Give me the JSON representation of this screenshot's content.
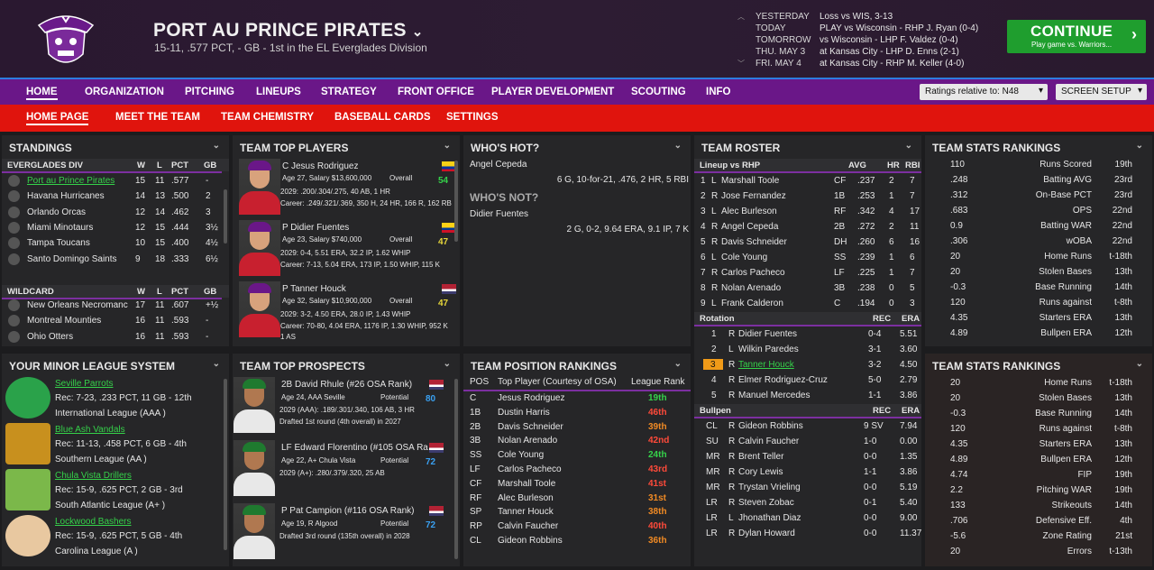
{
  "header": {
    "team_name": "PORT AU PRINCE PIRATES",
    "subtitle": "15-11, .577 PCT, - GB - 1st in the EL Everglades Division",
    "schedule": [
      {
        "label": "YESTERDAY",
        "value": "Loss vs WIS, 3-13"
      },
      {
        "label": "TODAY",
        "value": "PLAY vs Wisconsin - RHP J. Ryan (0-4)"
      },
      {
        "label": "TOMORROW",
        "value": "vs Wisconsin - LHP F. Valdez (0-4)"
      },
      {
        "label": "THU. MAY 3",
        "value": "at Kansas City - LHP D. Enns (2-1)"
      },
      {
        "label": "FRI. MAY 4",
        "value": "at Kansas City - RHP M. Keller (4-0)"
      }
    ],
    "continue_label": "CONTINUE",
    "continue_sub": "Play game vs. Warriors..."
  },
  "nav": {
    "main": [
      "HOME",
      "ORGANIZATION",
      "PITCHING",
      "LINEUPS",
      "STRATEGY",
      "FRONT OFFICE",
      "PLAYER DEVELOPMENT",
      "SCOUTING",
      "INFO"
    ],
    "ratings_dropdown": "Ratings relative to: N48",
    "screen_setup": "SCREEN SETUP",
    "sub": [
      "HOME PAGE",
      "MEET THE TEAM",
      "TEAM CHEMISTRY",
      "BASEBALL CARDS",
      "SETTINGS"
    ]
  },
  "standings": {
    "title": "STANDINGS",
    "div_name": "EVERGLADES DIV",
    "wildcard_name": "WILDCARD",
    "cols": [
      "W",
      "L",
      "PCT",
      "GB"
    ],
    "division": [
      {
        "team": "Port au Prince Pirates",
        "w": "15",
        "l": "11",
        "pct": ".577",
        "gb": "-"
      },
      {
        "team": "Havana Hurricanes",
        "w": "14",
        "l": "13",
        "pct": ".500",
        "gb": "2"
      },
      {
        "team": "Orlando Orcas",
        "w": "12",
        "l": "14",
        "pct": ".462",
        "gb": "3"
      },
      {
        "team": "Miami Minotaurs",
        "w": "12",
        "l": "15",
        "pct": ".444",
        "gb": "3½"
      },
      {
        "team": "Tampa Toucans",
        "w": "10",
        "l": "15",
        "pct": ".400",
        "gb": "4½"
      },
      {
        "team": "Santo Domingo Saints",
        "w": "9",
        "l": "18",
        "pct": ".333",
        "gb": "6½"
      }
    ],
    "wildcard": [
      {
        "team": "New Orleans Necromanc",
        "w": "17",
        "l": "11",
        "pct": ".607",
        "gb": "+½"
      },
      {
        "team": "Montreal Mounties",
        "w": "16",
        "l": "11",
        "pct": ".593",
        "gb": "-"
      },
      {
        "team": "Ohio Otters",
        "w": "16",
        "l": "11",
        "pct": ".593",
        "gb": "-"
      }
    ]
  },
  "top_players": {
    "title": "TEAM TOP PLAYERS",
    "players": [
      {
        "name": "C Jesus Rodriguez",
        "line1": "Age 27, Salary $13,600,000",
        "ovr_label": "Overall",
        "ovr": "54",
        "line2": "2029: .200/.304/.275, 40 AB, 1 HR",
        "line3": "Career: .249/.321/.369, 350 H, 24 HR, 166 R, 162 RB"
      },
      {
        "name": "P Didier Fuentes",
        "line1": "Age 23, Salary $740,000",
        "ovr_label": "Overall",
        "ovr": "47",
        "line2": "2029: 0-4, 5.51 ERA, 32.2 IP, 1.62 WHIP",
        "line3": "Career: 7-13, 5.04 ERA, 173 IP, 1.50 WHIP, 115 K"
      },
      {
        "name": "P Tanner Houck",
        "line1": "Age 32, Salary $10,900,000",
        "ovr_label": "Overall",
        "ovr": "47",
        "line2": "2029: 3-2, 4.50 ERA, 28.0 IP, 1.43 WHIP",
        "line3": "Career: 70-80, 4.04 ERA, 1176 IP, 1.30 WHIP, 952 K",
        "line4": "1 AS"
      }
    ]
  },
  "whos_hot": {
    "title": "WHO'S HOT?",
    "hot_name": "Angel Cepeda",
    "hot_line": "6 G, 10-for-21, .476, 2 HR, 5 RBI",
    "not_title": "WHO'S NOT?",
    "not_name": "Didier Fuentes",
    "not_line": "2 G, 0-2, 9.64 ERA, 9.1 IP, 7 K"
  },
  "roster": {
    "title": "TEAM ROSTER",
    "lineup_label": "Lineup vs RHP",
    "lineup_cols": [
      "AVG",
      "HR",
      "RBI"
    ],
    "lineup": [
      {
        "n": "1",
        "h": "L",
        "name": "Marshall Toole",
        "pos": "CF",
        "avg": ".237",
        "hr": "2",
        "rbi": "7"
      },
      {
        "n": "2",
        "h": "R",
        "name": "Jose Fernandez",
        "pos": "1B",
        "avg": ".253",
        "hr": "1",
        "rbi": "7"
      },
      {
        "n": "3",
        "h": "L",
        "name": "Alec Burleson",
        "pos": "RF",
        "avg": ".342",
        "hr": "4",
        "rbi": "17"
      },
      {
        "n": "4",
        "h": "R",
        "name": "Angel Cepeda",
        "pos": "2B",
        "avg": ".272",
        "hr": "2",
        "rbi": "11"
      },
      {
        "n": "5",
        "h": "R",
        "name": "Davis Schneider",
        "pos": "DH",
        "avg": ".260",
        "hr": "6",
        "rbi": "16"
      },
      {
        "n": "6",
        "h": "L",
        "name": "Cole Young",
        "pos": "SS",
        "avg": ".239",
        "hr": "1",
        "rbi": "6"
      },
      {
        "n": "7",
        "h": "R",
        "name": "Carlos Pacheco",
        "pos": "LF",
        "avg": ".225",
        "hr": "1",
        "rbi": "7"
      },
      {
        "n": "8",
        "h": "R",
        "name": "Nolan Arenado",
        "pos": "3B",
        "avg": ".238",
        "hr": "0",
        "rbi": "5"
      },
      {
        "n": "9",
        "h": "L",
        "name": "Frank Calderon",
        "pos": "C",
        "avg": ".194",
        "hr": "0",
        "rbi": "3"
      }
    ],
    "rotation_label": "Rotation",
    "rot_cols": [
      "REC",
      "ERA"
    ],
    "rotation": [
      {
        "n": "1",
        "h": "R",
        "name": "Didier Fuentes",
        "rec": "0-4",
        "era": "5.51"
      },
      {
        "n": "2",
        "h": "L",
        "name": "Wilkin Paredes",
        "rec": "3-1",
        "era": "3.60"
      },
      {
        "n": "3",
        "h": "R",
        "name": "Tanner Houck",
        "rec": "3-2",
        "era": "4.50",
        "hl": true
      },
      {
        "n": "4",
        "h": "R",
        "name": "Elmer Rodriguez-Cruz",
        "rec": "5-0",
        "era": "2.79"
      },
      {
        "n": "5",
        "h": "R",
        "name": "Manuel Mercedes",
        "rec": "1-1",
        "era": "3.86"
      }
    ],
    "bullpen_label": "Bullpen",
    "bullpen": [
      {
        "role": "CL",
        "h": "R",
        "name": "Gideon Robbins",
        "rec": "9 SV",
        "era": "7.94"
      },
      {
        "role": "SU",
        "h": "R",
        "name": "Calvin Faucher",
        "rec": "1-0",
        "era": "0.00"
      },
      {
        "role": "MR",
        "h": "R",
        "name": "Brent Teller",
        "rec": "0-0",
        "era": "1.35"
      },
      {
        "role": "MR",
        "h": "R",
        "name": "Cory Lewis",
        "rec": "1-1",
        "era": "3.86"
      },
      {
        "role": "MR",
        "h": "R",
        "name": "Trystan Vrieling",
        "rec": "0-0",
        "era": "5.19"
      },
      {
        "role": "LR",
        "h": "R",
        "name": "Steven Zobac",
        "rec": "0-1",
        "era": "5.40"
      },
      {
        "role": "LR",
        "h": "L",
        "name": "Jhonathan Diaz",
        "rec": "0-0",
        "era": "9.00"
      },
      {
        "role": "LR",
        "h": "R",
        "name": "Dylan Howard",
        "rec": "0-0",
        "era": "11.37"
      }
    ]
  },
  "stats1": {
    "title": "TEAM STATS RANKINGS",
    "rows": [
      {
        "v": "110",
        "s": "Runs Scored",
        "r": "19th"
      },
      {
        "v": ".248",
        "s": "Batting AVG",
        "r": "23rd"
      },
      {
        "v": ".312",
        "s": "On-Base PCT",
        "r": "23rd"
      },
      {
        "v": ".683",
        "s": "OPS",
        "r": "22nd"
      },
      {
        "v": "0.9",
        "s": "Batting WAR",
        "r": "22nd"
      },
      {
        "v": ".306",
        "s": "wOBA",
        "r": "22nd"
      },
      {
        "v": "20",
        "s": "Home Runs",
        "r": "t-18th"
      },
      {
        "v": "20",
        "s": "Stolen Bases",
        "r": "13th"
      },
      {
        "v": "-0.3",
        "s": "Base Running",
        "r": "14th"
      },
      {
        "v": "120",
        "s": "Runs against",
        "r": "t-8th"
      },
      {
        "v": "4.35",
        "s": "Starters ERA",
        "r": "13th"
      },
      {
        "v": "4.89",
        "s": "Bullpen ERA",
        "r": "12th"
      }
    ]
  },
  "stats2": {
    "title": "TEAM STATS RANKINGS",
    "rows": [
      {
        "v": "20",
        "s": "Home Runs",
        "r": "t-18th"
      },
      {
        "v": "20",
        "s": "Stolen Bases",
        "r": "13th"
      },
      {
        "v": "-0.3",
        "s": "Base Running",
        "r": "14th"
      },
      {
        "v": "120",
        "s": "Runs against",
        "r": "t-8th"
      },
      {
        "v": "4.35",
        "s": "Starters ERA",
        "r": "13th"
      },
      {
        "v": "4.89",
        "s": "Bullpen ERA",
        "r": "12th"
      },
      {
        "v": "4.74",
        "s": "FIP",
        "r": "19th"
      },
      {
        "v": "2.2",
        "s": "Pitching WAR",
        "r": "19th"
      },
      {
        "v": "133",
        "s": "Strikeouts",
        "r": "14th"
      },
      {
        "v": ".706",
        "s": "Defensive Eff.",
        "r": "4th"
      },
      {
        "v": "-5.6",
        "s": "Zone Rating",
        "r": "21st"
      },
      {
        "v": "20",
        "s": "Errors",
        "r": "t-13th"
      }
    ]
  },
  "minors": {
    "title": "YOUR MINOR LEAGUE SYSTEM",
    "teams": [
      {
        "name": "Seville Parrots",
        "rec": "Rec: 7-23, .233 PCT, 11 GB - 12th",
        "league": "International League (AAA )"
      },
      {
        "name": "Blue Ash Vandals",
        "rec": "Rec: 11-13, .458 PCT, 6 GB - 4th",
        "league": "Southern League (AA )"
      },
      {
        "name": "Chula Vista Drillers",
        "rec": "Rec: 15-9, .625 PCT, 2 GB - 3rd",
        "league": "South Atlantic League (A+ )"
      },
      {
        "name": "Lockwood Bashers",
        "rec": "Rec: 15-9, .625 PCT, 5 GB - 4th",
        "league": "Carolina League (A )"
      }
    ]
  },
  "prospects": {
    "title": "TEAM TOP PROSPECTS",
    "players": [
      {
        "name": "2B David Rhule (#26 OSA Rank)",
        "line1": "Age 24, AAA Seville",
        "pot_label": "Potential",
        "pot": "80",
        "line2": "2029 (AAA): .189/.301/.340, 106 AB, 3 HR",
        "line3": "Drafted 1st round (4th overall) in 2027"
      },
      {
        "name": "LF Edward Florentino (#105 OSA Ra",
        "line1": "Age 22, A+ Chula Vista",
        "pot_label": "Potential",
        "pot": "72",
        "line2": "2029 (A+): .280/.379/.320, 25 AB",
        "line3": ""
      },
      {
        "name": "P Pat Campion (#116 OSA Rank)",
        "line1": "Age 19, R Algood",
        "pot_label": "Potential",
        "pot": "72",
        "line2": "Drafted 3rd round (135th overall) in 2028",
        "line3": ""
      }
    ]
  },
  "positions": {
    "title": "TEAM POSITION RANKINGS",
    "cols": [
      "POS",
      "Top Player (Courtesy of OSA)",
      "League Rank"
    ],
    "rows": [
      {
        "pos": "C",
        "name": "Jesus Rodriguez",
        "rank": "19th",
        "c": "green"
      },
      {
        "pos": "1B",
        "name": "Dustin Harris",
        "rank": "46th",
        "c": "red"
      },
      {
        "pos": "2B",
        "name": "Davis Schneider",
        "rank": "39th",
        "c": "orange"
      },
      {
        "pos": "3B",
        "name": "Nolan Arenado",
        "rank": "42nd",
        "c": "red"
      },
      {
        "pos": "SS",
        "name": "Cole Young",
        "rank": "24th",
        "c": "green"
      },
      {
        "pos": "LF",
        "name": "Carlos Pacheco",
        "rank": "43rd",
        "c": "red"
      },
      {
        "pos": "CF",
        "name": "Marshall Toole",
        "rank": "41st",
        "c": "red"
      },
      {
        "pos": "RF",
        "name": "Alec Burleson",
        "rank": "31st",
        "c": "orange"
      },
      {
        "pos": "SP",
        "name": "Tanner Houck",
        "rank": "38th",
        "c": "orange"
      },
      {
        "pos": "RP",
        "name": "Calvin Faucher",
        "rank": "40th",
        "c": "red"
      },
      {
        "pos": "CL",
        "name": "Gideon Robbins",
        "rank": "36th",
        "c": "orange"
      }
    ]
  },
  "colors": {
    "nav_primary": "#6a1788",
    "nav_secondary": "#e0140d",
    "continue": "#1f9e2e",
    "link": "#35d24a"
  }
}
